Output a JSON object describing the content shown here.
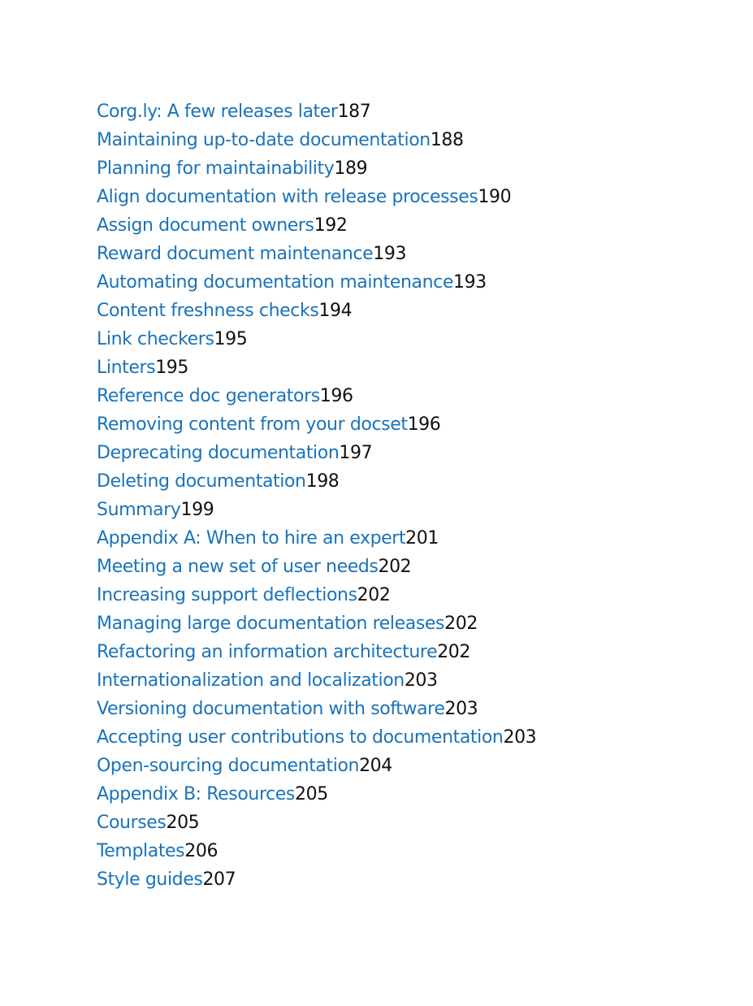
{
  "toc": {
    "entries": [
      {
        "title": "Corg.ly: A few releases later",
        "page": "187"
      },
      {
        "title": "Maintaining up-to-date documentation",
        "page": "188"
      },
      {
        "title": "Planning for maintainability",
        "page": "189"
      },
      {
        "title": "Align documentation with release processes",
        "page": "190"
      },
      {
        "title": "Assign document owners",
        "page": "192"
      },
      {
        "title": "Reward document maintenance",
        "page": "193"
      },
      {
        "title": "Automating documentation maintenance",
        "page": "193"
      },
      {
        "title": "Content freshness checks",
        "page": "194"
      },
      {
        "title": "Link checkers",
        "page": "195"
      },
      {
        "title": "Linters",
        "page": "195"
      },
      {
        "title": "Reference doc generators",
        "page": "196"
      },
      {
        "title": "Removing content from your docset",
        "page": "196"
      },
      {
        "title": "Deprecating documentation",
        "page": "197"
      },
      {
        "title": "Deleting documentation",
        "page": "198"
      },
      {
        "title": "Summary",
        "page": "199"
      },
      {
        "title": "Appendix A: When to hire an expert",
        "page": "201"
      },
      {
        "title": "Meeting a new set of user needs",
        "page": "202"
      },
      {
        "title": "Increasing support deflections",
        "page": "202"
      },
      {
        "title": "Managing large documentation releases",
        "page": "202"
      },
      {
        "title": "Refactoring an information architecture",
        "page": "202"
      },
      {
        "title": "Internationalization and localization",
        "page": "203"
      },
      {
        "title": "Versioning documentation with software",
        "page": "203"
      },
      {
        "title": "Accepting user contributions to documentation",
        "page": "203"
      },
      {
        "title": "Open-sourcing documentation",
        "page": "204"
      },
      {
        "title": "Appendix B: Resources",
        "page": "205"
      },
      {
        "title": "Courses",
        "page": "205"
      },
      {
        "title": "Templates",
        "page": "206"
      },
      {
        "title": "Style guides",
        "page": "207"
      }
    ]
  },
  "colors": {
    "link": "#1a73b8",
    "page_number": "#111111"
  }
}
